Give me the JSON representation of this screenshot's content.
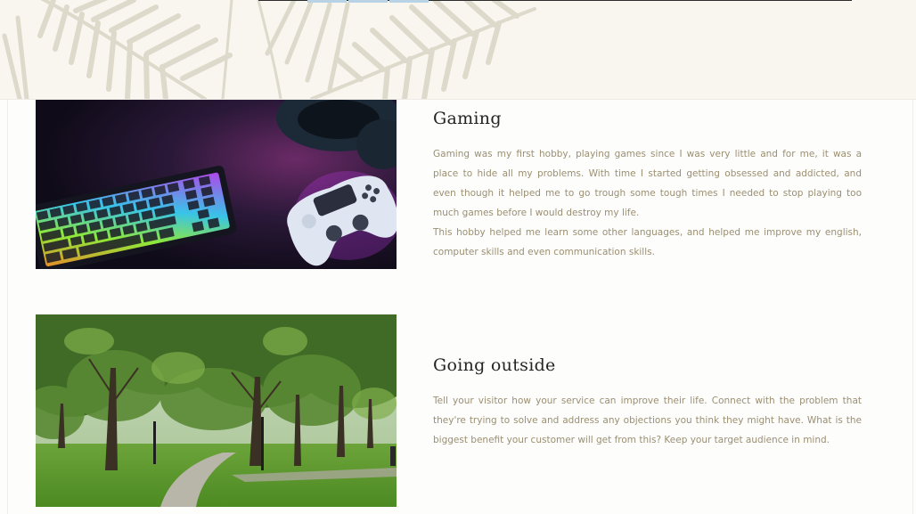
{
  "header": {
    "decoration_icon": "palm-leaf-icon",
    "background_color": "#f8f6ef",
    "leaf_color": "#ddd9cb"
  },
  "sections": [
    {
      "title": "Gaming",
      "image_icon": "keyboard-controller-photo",
      "paragraphs": [
        "Gaming was my first hobby, playing games since I was very little and for me, it was a place to hide all my problems. With time I started getting obsessed and addicted, and even though it helped me to go trough some tough times I needed to stop playing too much games before I would destroy my life.",
        "This hobby helped me learn some other languages, and helped me improve my english, computer skills and even communication skills."
      ]
    },
    {
      "title": "Going outside",
      "image_icon": "park-trees-photo",
      "paragraphs": [
        "Tell your visitor how your service can improve their life. Connect with the problem that they're trying to solve and address any objections you think they might have. What is the biggest benefit your customer will get from this? Keep your target audience in mind."
      ]
    }
  ],
  "colors": {
    "title": "#242424",
    "body_text": "#9b8f72",
    "page_background": "#fdfdfb"
  }
}
